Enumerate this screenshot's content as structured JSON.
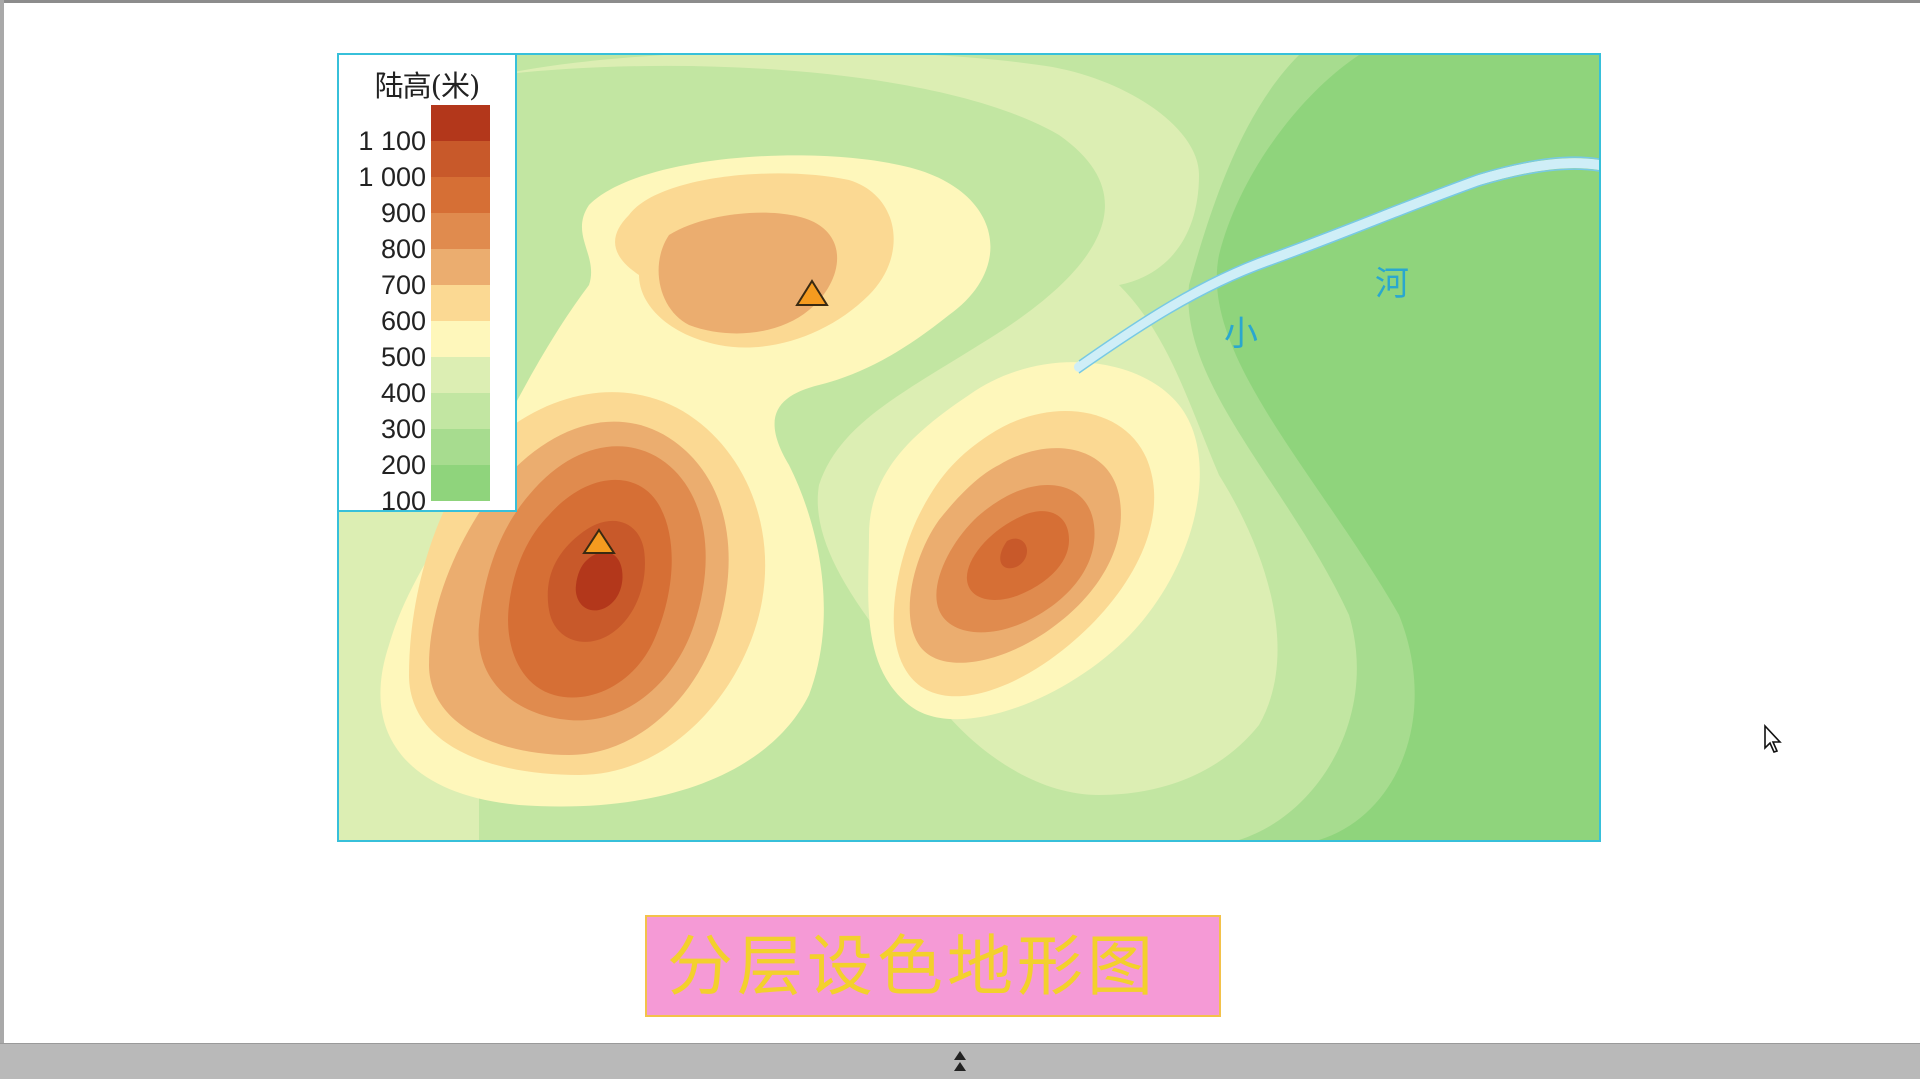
{
  "legend": {
    "title": "陆高(米)",
    "ticks": [
      "1 100",
      "1 000",
      "900",
      "800",
      "700",
      "600",
      "500",
      "400",
      "300",
      "200",
      "100"
    ],
    "colors": [
      "#b3371b",
      "#c8592a",
      "#d66f35",
      "#e08b4e",
      "#ebad6f",
      "#fbd993",
      "#fef7bb",
      "#dceeb3",
      "#c2e6a2",
      "#a7dc8f",
      "#8fd47c"
    ]
  },
  "map": {
    "river_labels": [
      "小",
      "河"
    ],
    "river_color": "#cfeef7",
    "label_color": "#2aa7cf"
  },
  "caption": {
    "text": "分层设色地形图"
  },
  "colors": {
    "frame": "#37c0da",
    "caption_bg": "#f59ad6",
    "caption_text": "#f3d02c"
  }
}
